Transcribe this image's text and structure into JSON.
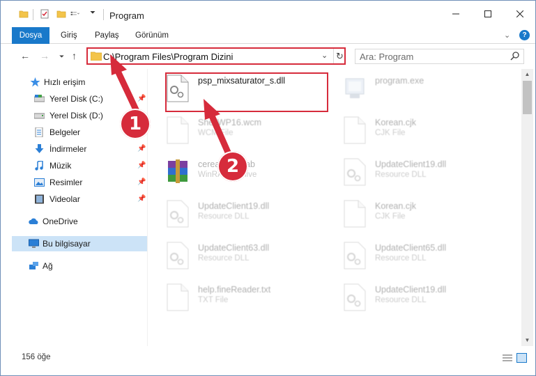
{
  "window": {
    "title": "Program",
    "controls": {
      "minimize": "—",
      "maximize": "☐",
      "close": "✕"
    }
  },
  "ribbon": {
    "tabs": [
      "Dosya",
      "Giriş",
      "Paylaş",
      "Görünüm"
    ],
    "collapse_icon": "chevron-down-icon",
    "help_label": "?"
  },
  "nav": {
    "address": "C:\\Program Files\\Program Dizini",
    "search_placeholder": "Ara: Program"
  },
  "sidebar": {
    "quick_access": "Hızlı erişim",
    "items": [
      {
        "label": "Yerel Disk (C:)",
        "pinned": true
      },
      {
        "label": "Yerel Disk (D:)",
        "pinned": false
      },
      {
        "label": "Belgeler",
        "pinned": true
      },
      {
        "label": "İndirmeler",
        "pinned": true
      },
      {
        "label": "Müzik",
        "pinned": true
      },
      {
        "label": "Resimler",
        "pinned": true
      },
      {
        "label": "Videolar",
        "pinned": true
      }
    ],
    "onedrive": "OneDrive",
    "this_pc": "Bu bilgisayar",
    "network": "Ağ"
  },
  "files": [
    {
      "name": "psp_mixsaturator_s.dll",
      "type": "",
      "icon": "dll-icon",
      "faded": false
    },
    {
      "name": "program.exe",
      "type": "",
      "icon": "exe-icon",
      "faded": true
    },
    {
      "name": "ShellWP16.wcm",
      "type": "WCM File",
      "icon": "file-icon",
      "faded": true
    },
    {
      "name": "Korean.cjk",
      "type": "CJK File",
      "icon": "file-icon",
      "faded": true
    },
    {
      "name": "cereal_res.cab",
      "type": "WinRAR archive",
      "icon": "archive-icon",
      "faded": true
    },
    {
      "name": "UpdateClient19.dll",
      "type": "Resource DLL",
      "icon": "dll-icon",
      "faded": true
    },
    {
      "name": "UpdateClient19.dll",
      "type": "Resource DLL",
      "icon": "dll-icon",
      "faded": true
    },
    {
      "name": "Korean.cjk",
      "type": "CJK File",
      "icon": "file-icon",
      "faded": true
    },
    {
      "name": "UpdateClient63.dll",
      "type": "Resource DLL",
      "icon": "dll-icon",
      "faded": true
    },
    {
      "name": "UpdateClient65.dll",
      "type": "Resource DLL",
      "icon": "dll-icon",
      "faded": true
    },
    {
      "name": "help.fineReader.txt",
      "type": "TXT File",
      "icon": "file-icon",
      "faded": true
    },
    {
      "name": "UpdateClient19.dll",
      "type": "Resource DLL",
      "icon": "dll-icon",
      "faded": true
    }
  ],
  "status": {
    "item_count": "156 öğe"
  },
  "annotations": {
    "step1": "1",
    "step2": "2",
    "color": "#d62b3b"
  }
}
